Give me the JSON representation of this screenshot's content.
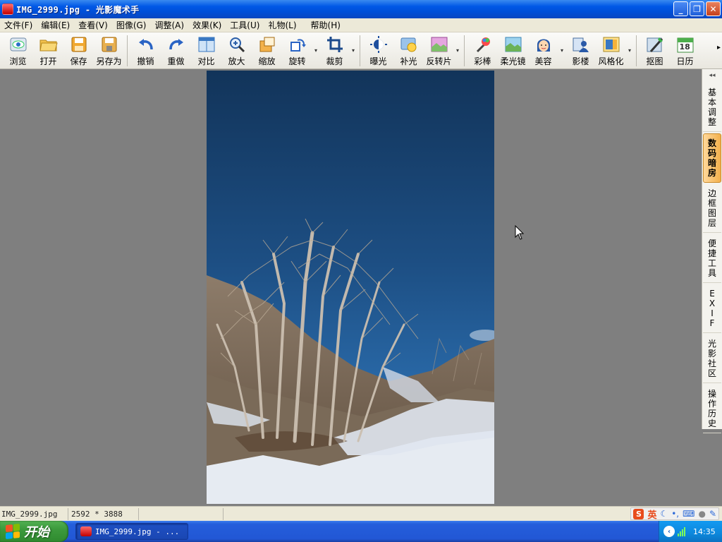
{
  "window": {
    "title": "IMG_2999.jpg - 光影魔术手",
    "minimize_label": "_",
    "maximize_label": "❐",
    "close_label": "✕"
  },
  "menu": [
    {
      "label": "文件(F)"
    },
    {
      "label": "编辑(E)"
    },
    {
      "label": "查看(V)"
    },
    {
      "label": "图像(G)"
    },
    {
      "label": "调整(A)"
    },
    {
      "label": "效果(K)"
    },
    {
      "label": "工具(U)"
    },
    {
      "label": "礼物(L)"
    },
    {
      "label": "帮助(H)"
    }
  ],
  "toolbar": {
    "browse": "浏览",
    "open": "打开",
    "save": "保存",
    "save_as": "另存为",
    "undo": "撤销",
    "redo": "重做",
    "compare": "对比",
    "zoom_in": "放大",
    "resize": "缩放",
    "rotate": "旋转",
    "crop": "裁剪",
    "exposure": "曝光",
    "fill_light": "补光",
    "invert": "反转片",
    "color_pick": "彩棒",
    "soft_lens": "柔光镜",
    "beauty": "美容",
    "studio": "影楼",
    "stylize": "风格化",
    "cutout": "抠图",
    "calendar": "日历",
    "calendar_day": "18",
    "more_arrow": "▸"
  },
  "side_panel": {
    "collapse": "◂◂",
    "tabs": [
      {
        "chars": [
          "基",
          "本",
          "调",
          "整"
        ],
        "active": false
      },
      {
        "chars": [
          "数",
          "码",
          "暗",
          "房"
        ],
        "active": true
      },
      {
        "chars": [
          "边",
          "框",
          "图",
          "层"
        ],
        "active": false
      },
      {
        "chars": [
          "便",
          "捷",
          "工",
          "具"
        ],
        "active": false
      },
      {
        "chars": [
          "E",
          "X",
          "I",
          "F"
        ],
        "active": false
      },
      {
        "chars": [
          "光",
          "影",
          "社",
          "区"
        ],
        "active": false
      },
      {
        "chars": [
          "操",
          "作",
          "历",
          "史"
        ],
        "active": false
      }
    ]
  },
  "status": {
    "filename": "IMG_2999.jpg",
    "dimensions": "2592 * 3888",
    "ime_logo": "S",
    "ime_mode": "英"
  },
  "taskbar": {
    "start_label": "开始",
    "task_label": "IMG_2999.jpg - ...",
    "clock": "14:35"
  },
  "colors": {
    "sky_top": "#12345a",
    "sky_bottom": "#2c6fb0",
    "accent_panel": "#f3b04c"
  }
}
